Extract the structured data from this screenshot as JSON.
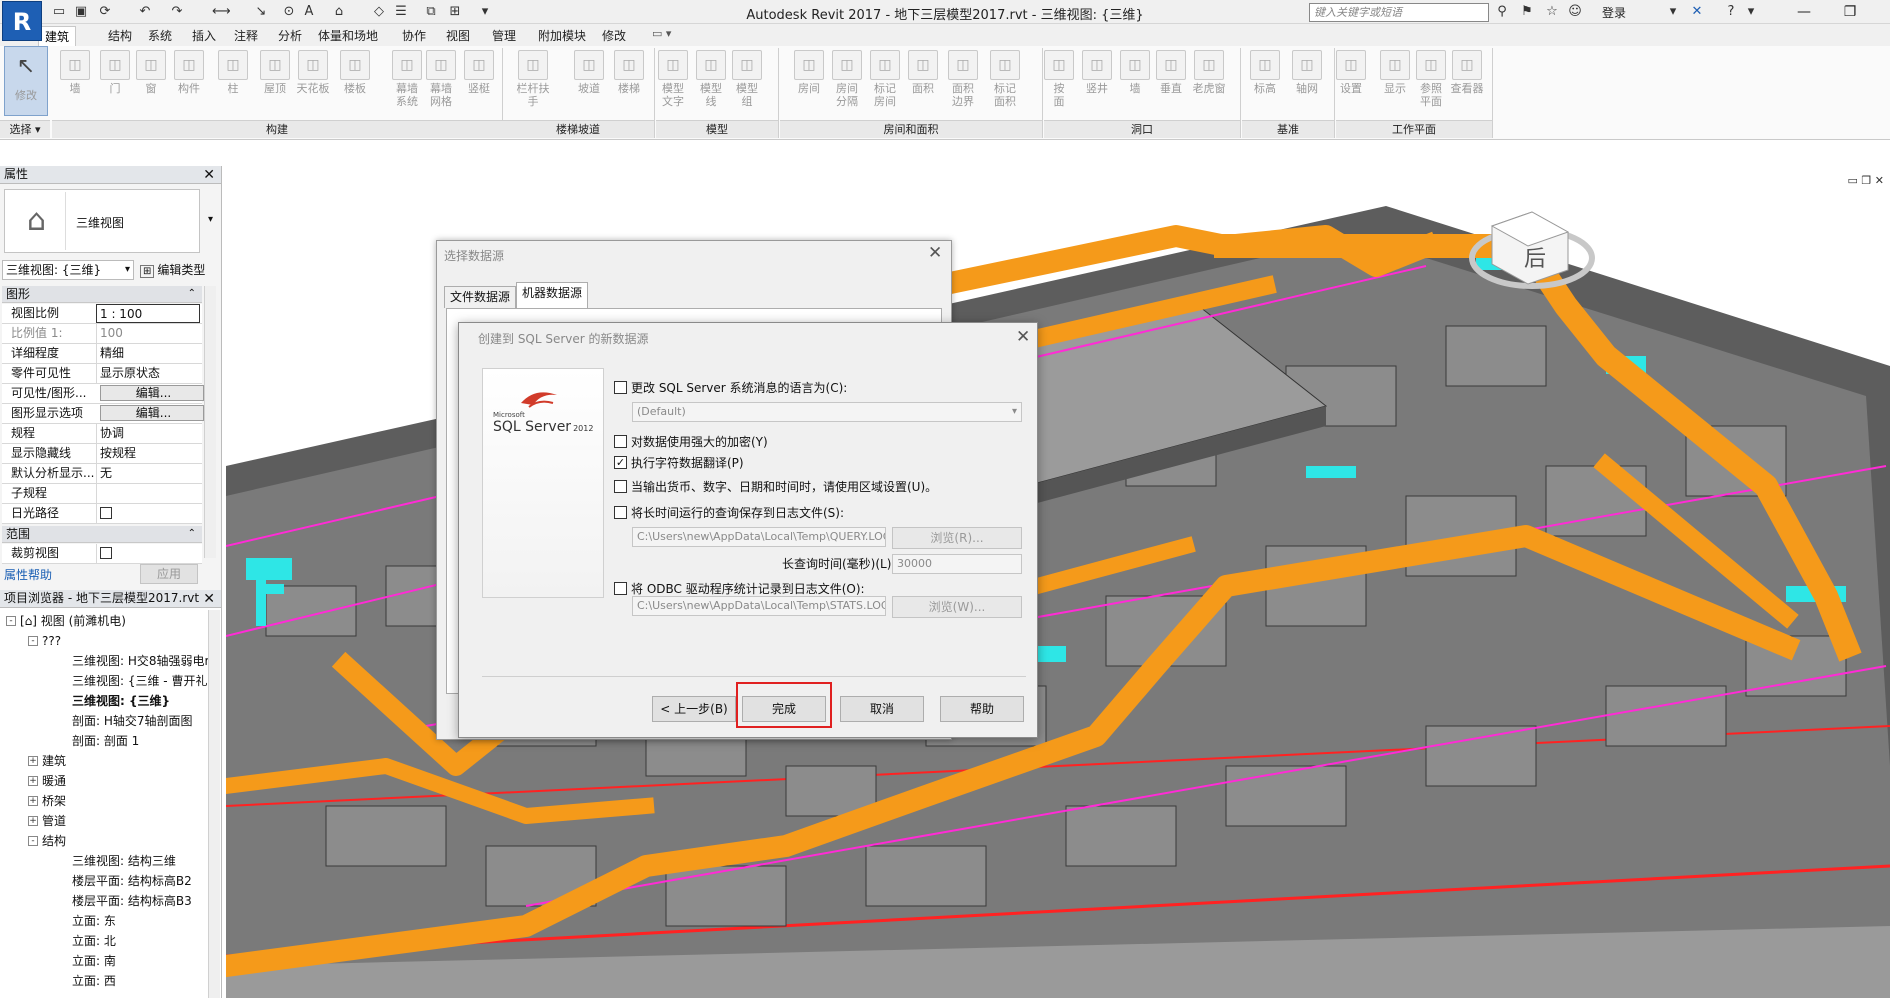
{
  "app": {
    "logo_letter": "R",
    "title": "Autodesk Revit 2017 -     地下三层模型2017.rvt - 三维视图: {三维}"
  },
  "titlebar": {
    "search_placeholder": "键入关键字或短语",
    "login_label": "登录"
  },
  "tabs": [
    "建筑",
    "结构",
    "系统",
    "插入",
    "注释",
    "分析",
    "体量和场地",
    "协作",
    "视图",
    "管理",
    "附加模块",
    "修改"
  ],
  "ribbon": {
    "select_label": "选择",
    "modify_label": "修改",
    "tools": [
      {
        "label": "墙",
        "icon": "wall-icon"
      },
      {
        "label": "门",
        "icon": "door-icon"
      },
      {
        "label": "窗",
        "icon": "window-icon"
      },
      {
        "label": "构件",
        "icon": "component-icon"
      },
      {
        "label": "柱",
        "icon": "column-icon"
      },
      {
        "label": "屋顶",
        "icon": "roof-icon"
      },
      {
        "label": "天花板",
        "icon": "ceiling-icon"
      },
      {
        "label": "楼板",
        "icon": "floor-icon"
      },
      {
        "label": "幕墙\n系统",
        "icon": "curtain-system-icon"
      },
      {
        "label": "幕墙\n网格",
        "icon": "curtain-grid-icon"
      },
      {
        "label": "竖梃",
        "icon": "mullion-icon"
      },
      {
        "label": "栏杆扶手",
        "icon": "railing-icon"
      },
      {
        "label": "坡道",
        "icon": "ramp-icon"
      },
      {
        "label": "楼梯",
        "icon": "stair-icon"
      },
      {
        "label": "模型\n文字",
        "icon": "model-text-icon"
      },
      {
        "label": "模型\n线",
        "icon": "model-line-icon"
      },
      {
        "label": "模型\n组",
        "icon": "model-group-icon"
      },
      {
        "label": "房间",
        "icon": "room-icon"
      },
      {
        "label": "房间\n分隔",
        "icon": "room-separator-icon"
      },
      {
        "label": "标记\n房间",
        "icon": "tag-room-icon"
      },
      {
        "label": "面积",
        "icon": "area-icon"
      },
      {
        "label": "面积\n边界",
        "icon": "area-boundary-icon"
      },
      {
        "label": "标记\n面积",
        "icon": "tag-area-icon"
      },
      {
        "label": "按\n面",
        "icon": "by-face-icon"
      },
      {
        "label": "竖井",
        "icon": "shaft-icon"
      },
      {
        "label": "墙",
        "icon": "wall-opening-icon"
      },
      {
        "label": "垂直",
        "icon": "vertical-opening-icon"
      },
      {
        "label": "老虎窗",
        "icon": "dormer-icon"
      },
      {
        "label": "标高",
        "icon": "level-icon"
      },
      {
        "label": "轴网",
        "icon": "grid-icon"
      },
      {
        "label": "设置",
        "icon": "set-workplane-icon"
      },
      {
        "label": "显示",
        "icon": "show-workplane-icon"
      },
      {
        "label": "参照\n平面",
        "icon": "ref-plane-icon"
      },
      {
        "label": "查看器",
        "icon": "viewer-icon"
      }
    ],
    "panels": [
      "构建",
      "楼梯坡道",
      "模型",
      "房间和面积",
      "洞口",
      "基准",
      "工作平面"
    ]
  },
  "properties": {
    "title": "属性",
    "type_name": "三维视图",
    "instance_selector": "三维视图: {三维}",
    "edit_type": "编辑类型",
    "category_graphics": "图形",
    "category_extents": "范围",
    "rows": [
      {
        "name": "视图比例",
        "value": "1 : 100"
      },
      {
        "name": "比例值 1:",
        "value": "100"
      },
      {
        "name": "详细程度",
        "value": "精细"
      },
      {
        "name": "零件可见性",
        "value": "显示原状态"
      },
      {
        "name": "可见性/图形...",
        "value": "编辑..."
      },
      {
        "name": "图形显示选项",
        "value": "编辑..."
      },
      {
        "name": "规程",
        "value": "协调"
      },
      {
        "name": "显示隐藏线",
        "value": "按规程"
      },
      {
        "name": "默认分析显示...",
        "value": "无"
      },
      {
        "name": "子规程",
        "value": ""
      },
      {
        "name": "日光路径",
        "value": ""
      }
    ],
    "crop_row": "裁剪视图",
    "help_link": "属性帮助",
    "apply": "应用"
  },
  "browser": {
    "title": "项目浏览器 - 地下三层模型2017.rvt",
    "nodes": [
      {
        "text": "视图 (前濉机电)",
        "level": 0,
        "exp": "-",
        "bold": false
      },
      {
        "text": "???",
        "level": 1,
        "exp": "-",
        "bold": false
      },
      {
        "text": "三维视图: H交8轴强弱电r",
        "level": 2,
        "exp": "",
        "bold": false
      },
      {
        "text": "三维视图: {三维 - 曹开礼",
        "level": 2,
        "exp": "",
        "bold": false
      },
      {
        "text": "三维视图: {三维}",
        "level": 2,
        "exp": "",
        "bold": true
      },
      {
        "text": "剖面: H轴交7轴剖面图",
        "level": 2,
        "exp": "",
        "bold": false
      },
      {
        "text": "剖面: 剖面 1",
        "level": 2,
        "exp": "",
        "bold": false
      },
      {
        "text": "建筑",
        "level": 1,
        "exp": "+",
        "bold": false
      },
      {
        "text": "暖通",
        "level": 1,
        "exp": "+",
        "bold": false
      },
      {
        "text": "桥架",
        "level": 1,
        "exp": "+",
        "bold": false
      },
      {
        "text": "管道",
        "level": 1,
        "exp": "+",
        "bold": false
      },
      {
        "text": "结构",
        "level": 1,
        "exp": "-",
        "bold": false
      },
      {
        "text": "三维视图: 结构三维",
        "level": 2,
        "exp": "",
        "bold": false
      },
      {
        "text": "楼层平面: 结构标高B2",
        "level": 2,
        "exp": "",
        "bold": false
      },
      {
        "text": "楼层平面: 结构标高B3",
        "level": 2,
        "exp": "",
        "bold": false
      },
      {
        "text": "立面: 东",
        "level": 2,
        "exp": "",
        "bold": false
      },
      {
        "text": "立面: 北",
        "level": 2,
        "exp": "",
        "bold": false
      },
      {
        "text": "立面: 南",
        "level": 2,
        "exp": "",
        "bold": false
      },
      {
        "text": "立面: 西",
        "level": 2,
        "exp": "",
        "bold": false
      }
    ]
  },
  "viewcube": {
    "face_label": "后"
  },
  "dialog_datasource": {
    "title": "选择数据源",
    "tab_file": "文件数据源",
    "tab_machine": "机器数据源"
  },
  "dialog_sql": {
    "title": "创建到 SQL Server 的新数据源",
    "logo_small": "Microsoft",
    "logo_main": "SQL Server",
    "logo_version": "2012",
    "opt_language": "更改 SQL Server 系统消息的语言为(C):",
    "language_value": "(Default)",
    "opt_encrypt": "对数据使用强大的加密(Y)",
    "opt_translate": "执行字符数据翻译(P)",
    "opt_regional": "当输出货币、数字、日期和时间时，请使用区域设置(U)。",
    "opt_longquery": "将长时间运行的查询保存到日志文件(S):",
    "query_log_path": "C:\\Users\\new\\AppData\\Local\\Temp\\QUERY.LOG",
    "browse_r": "浏览(R)...",
    "long_query_time_label": "长查询时间(毫秒)(L):",
    "long_query_time_value": "30000",
    "opt_odbc": "将 ODBC 驱动程序统计记录到日志文件(O):",
    "stats_log_path": "C:\\Users\\new\\AppData\\Local\\Temp\\STATS.LOG",
    "browse_w": "浏览(W)...",
    "btn_back": "< 上一步(B)",
    "btn_finish": "完成",
    "btn_cancel": "取消",
    "btn_help": "帮助",
    "translate_checked": true,
    "highlight_color": "#e02020"
  },
  "colors": {
    "duct_orange": "#f59a1a",
    "pipe_cyan": "#2ee6e6",
    "line_magenta": "#ff2bd6",
    "line_red": "#ff2222",
    "concrete": "#6f6f6f",
    "revit_blue": "#1e5fb4"
  }
}
